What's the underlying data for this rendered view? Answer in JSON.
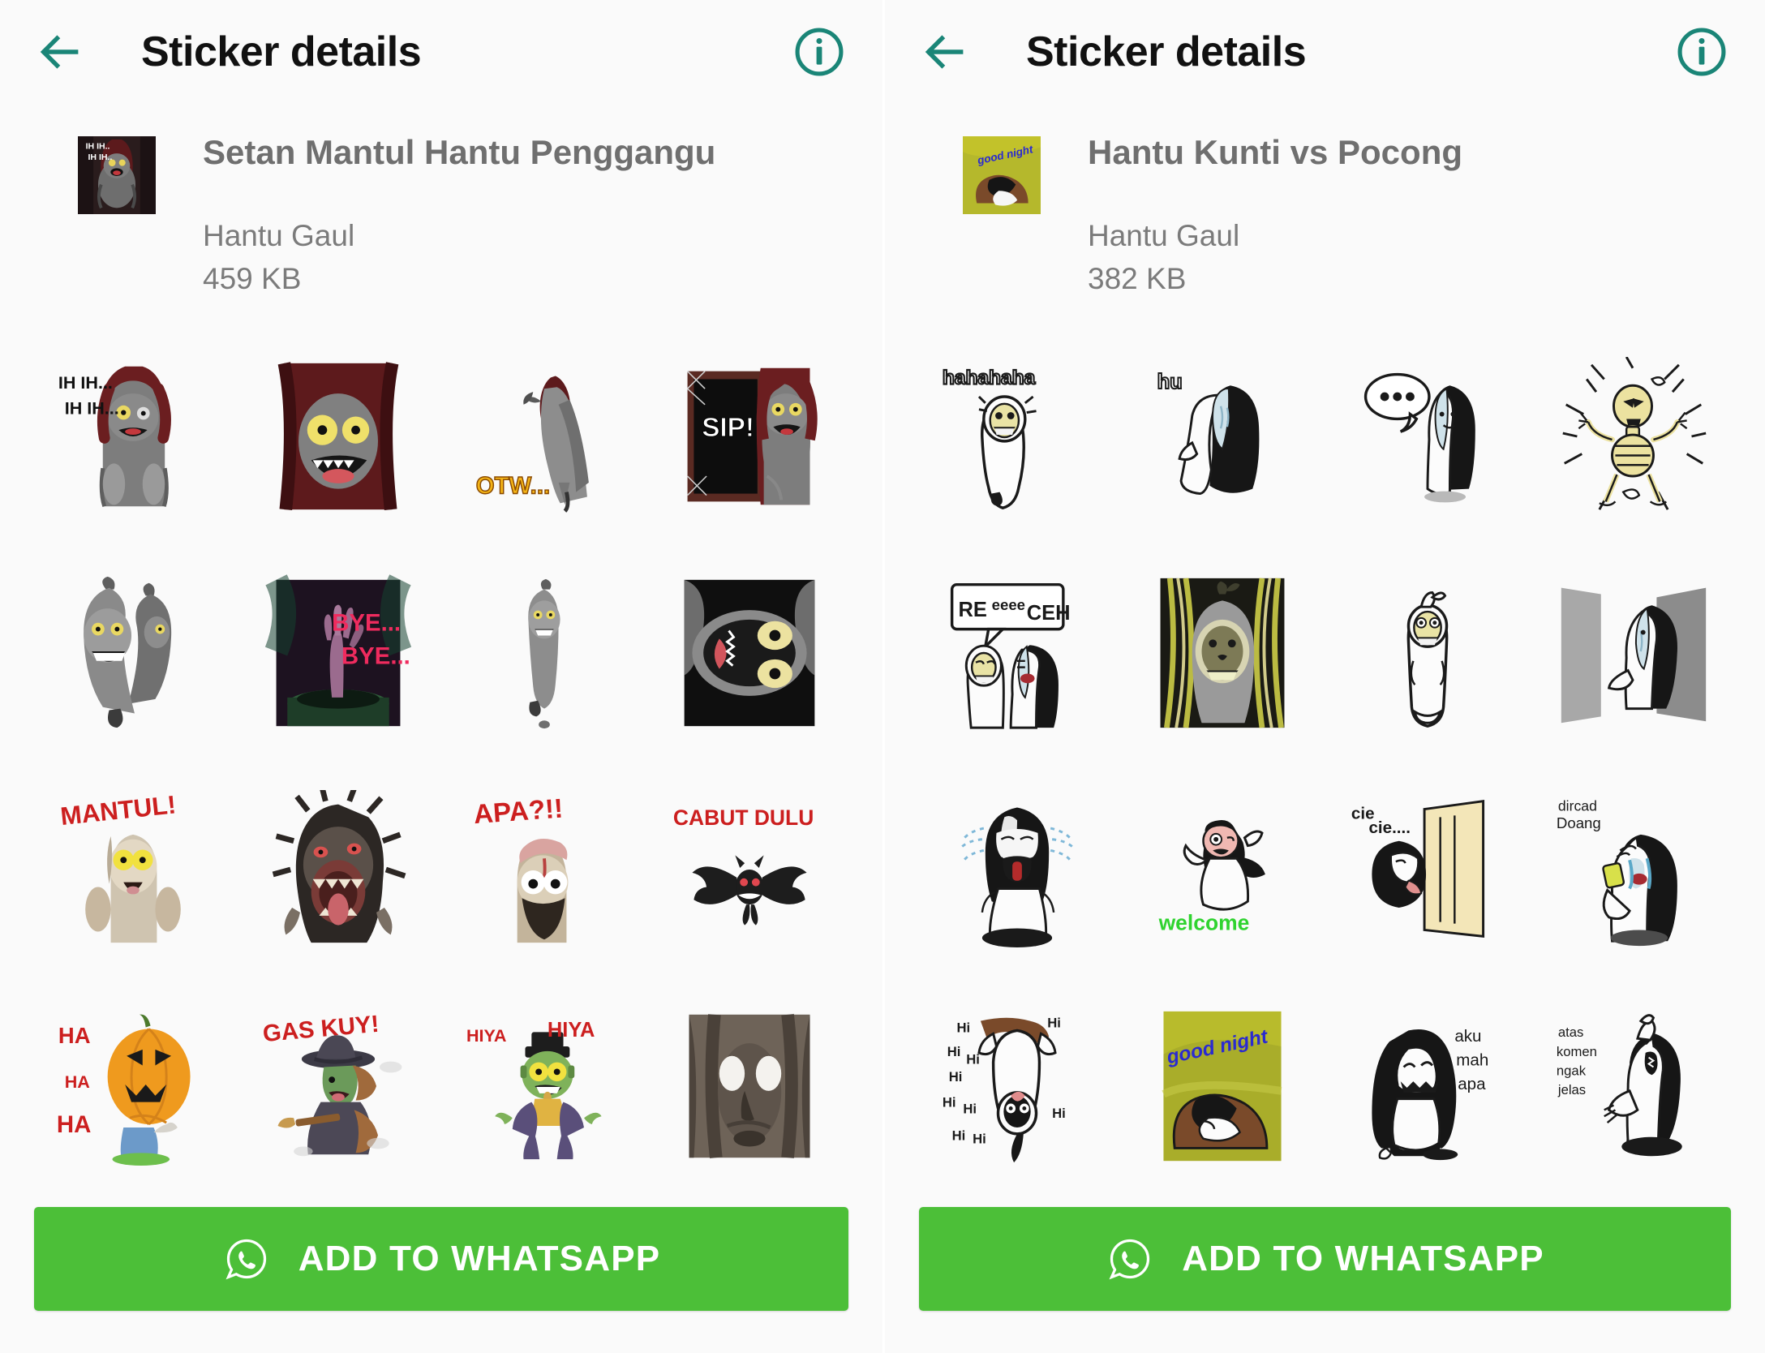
{
  "theme": {
    "accent_teal": "#1a8577",
    "whatsapp_green": "#4cbf38",
    "title_color": "#111111",
    "meta_color": "#7b7b7b",
    "background": "#fafafa"
  },
  "panels": [
    {
      "appbar": {
        "back_icon": "arrow-left-icon",
        "title": "Sticker details",
        "info_icon": "info-circle-icon"
      },
      "pack": {
        "tray_icon": "sticker-tray-ih-ih-ghost",
        "title": "Setan Mantul Hantu Penggangu",
        "publisher": "Hantu Gaul",
        "size": "459 KB"
      },
      "stickers": [
        {
          "id": "s1",
          "caption": "IH IH...\nIH IH...",
          "art": "ghost-ih-ih"
        },
        {
          "id": "s2",
          "caption": "",
          "art": "ghost-closeup-red-hair"
        },
        {
          "id": "s3",
          "caption": "OTW...",
          "art": "ghost-hanging-otw"
        },
        {
          "id": "s4",
          "caption": "SIP!",
          "art": "ghost-mirror-sip"
        },
        {
          "id": "s5",
          "caption": "",
          "art": "pocong-pair-grin"
        },
        {
          "id": "s6",
          "caption": "BYE...\nBYE...",
          "art": "hand-in-well-bye"
        },
        {
          "id": "s7",
          "caption": "",
          "art": "pocong-floating-small"
        },
        {
          "id": "s8",
          "caption": "",
          "art": "face-upside-down-dark"
        },
        {
          "id": "s9",
          "caption": "MANTUL!",
          "art": "ghost-thumbs-up-mantul"
        },
        {
          "id": "s10",
          "caption": "",
          "art": "ghost-screaming-hair"
        },
        {
          "id": "s11",
          "caption": "APA?!!",
          "art": "ghost-beard-apa"
        },
        {
          "id": "s12",
          "caption": "CABUT DULU",
          "art": "bat-cabut-dulu"
        },
        {
          "id": "s13",
          "caption": "HA\nHA\nHA",
          "art": "pumpkin-head-ha"
        },
        {
          "id": "s14",
          "caption": "GAS KUY!",
          "art": "witch-broom-gas-kuy"
        },
        {
          "id": "s15",
          "caption": "HIYA  HIYA",
          "art": "zombie-frankenstein-hiya"
        },
        {
          "id": "s16",
          "caption": "",
          "art": "dark-face-white-eyes"
        }
      ],
      "add_button": {
        "icon": "whatsapp-icon",
        "label": "ADD TO WHATSAPP"
      }
    },
    {
      "appbar": {
        "back_icon": "arrow-left-icon",
        "title": "Sticker details",
        "info_icon": "info-circle-icon"
      },
      "pack": {
        "tray_icon": "sticker-tray-good-night",
        "title": "Hantu Kunti vs Pocong",
        "publisher": "Hantu Gaul",
        "size": "382 KB"
      },
      "stickers": [
        {
          "id": "r1",
          "caption": "hahahaha",
          "art": "pocong-laughing"
        },
        {
          "id": "r2",
          "caption": "hu",
          "art": "kunti-hu"
        },
        {
          "id": "r3",
          "caption": "...",
          "art": "kunti-speech-dots"
        },
        {
          "id": "r4",
          "caption": "",
          "art": "skeleton-burst"
        },
        {
          "id": "r5",
          "caption": "REeeeCEH",
          "art": "pocong-kunti-receh"
        },
        {
          "id": "r6",
          "caption": "",
          "art": "pocong-glow-yellow"
        },
        {
          "id": "r7",
          "caption": "",
          "art": "pocong-waving"
        },
        {
          "id": "r8",
          "caption": "",
          "art": "kunti-behind-door"
        },
        {
          "id": "r9",
          "caption": "",
          "art": "kunti-crying-loud"
        },
        {
          "id": "r10",
          "caption": "welcome",
          "art": "kunti-welcome"
        },
        {
          "id": "r11",
          "caption": "cie cie....",
          "art": "kunti-peeking-door-cie"
        },
        {
          "id": "r12",
          "caption": "dircad\nDoang",
          "art": "kunti-phone-dircad"
        },
        {
          "id": "r13",
          "caption": "Hi Hi Hi Hi Hi Hi",
          "art": "pocong-upside-down-hi"
        },
        {
          "id": "r14",
          "caption": "good night",
          "art": "kunti-sleeping-good-night"
        },
        {
          "id": "r15",
          "caption": "aku\nmah\napa",
          "art": "kunti-sitting-aku-mah-apa"
        },
        {
          "id": "r16",
          "caption": "atas\nkomen\nngak\njelas",
          "art": "kunti-pointing-up-komen"
        }
      ],
      "add_button": {
        "icon": "whatsapp-icon",
        "label": "ADD TO WHATSAPP"
      }
    }
  ]
}
